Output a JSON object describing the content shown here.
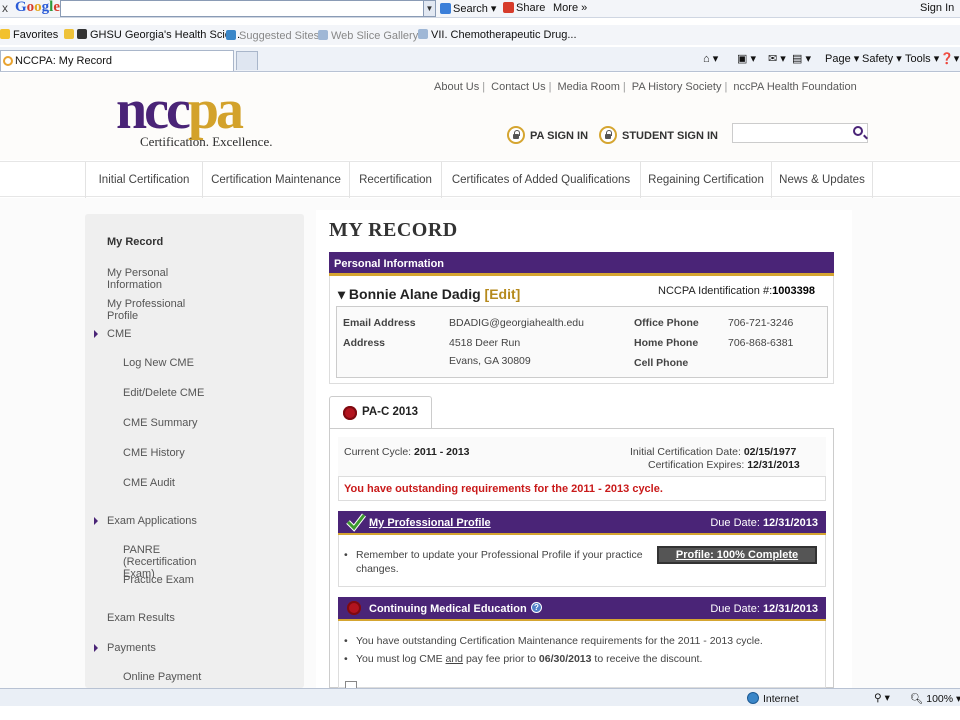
{
  "browser": {
    "close_glyph": "x",
    "google_label": "Google",
    "toolbar": {
      "search": "Search",
      "share": "Share",
      "more": "More »",
      "signin": "Sign In"
    },
    "favorites_label": "Favorites",
    "favorites": [
      "GHSU Georgia's Health Scie...",
      "Suggested Sites ▾",
      "Web Slice Gallery ▾",
      "VII. Chemotherapeutic Drug..."
    ],
    "tab_title": "NCCPA: My Record",
    "commands": {
      "page": "Page ▾",
      "safety": "Safety ▾",
      "tools": "Tools ▾"
    },
    "status": {
      "zone": "Internet",
      "zoom": "100%"
    }
  },
  "site": {
    "logo": {
      "text_left": "ncc",
      "text_right": "pa",
      "tagline": "Certification. Excellence."
    },
    "top_links": [
      "About Us",
      "Contact Us",
      "Media Room",
      "PA History Society",
      "nccPA Health Foundation"
    ],
    "pa_signin": "PA SIGN IN",
    "student_signin": "STUDENT SIGN IN",
    "search_placeholder": "",
    "nav": [
      "Initial Certification",
      "Certification Maintenance",
      "Recertification",
      "Certificates of Added Qualifications",
      "Regaining Certification",
      "News & Updates"
    ]
  },
  "sidebar": {
    "items": [
      "My Record",
      "My Personal Information",
      "My Professional Profile",
      "CME",
      "Log New CME",
      "Edit/Delete CME",
      "CME Summary",
      "CME History",
      "CME Audit",
      "Exam Applications",
      "PANRE (Recertification Exam)",
      "Practice Exam",
      "Exam Results",
      "Payments",
      "Online Payment"
    ]
  },
  "record": {
    "title": "MY RECORD",
    "personal_header": "Personal Information",
    "name": "Bonnie Alane Dadig",
    "edit": "[Edit]",
    "id_label": "NCCPA Identification #:",
    "id_value": "1003398",
    "email_label": "Email Address",
    "email": "BDADIG@georgiahealth.edu",
    "address_label": "Address",
    "address_line1": "4518 Deer Run",
    "address_line2": "Evans, GA 30809",
    "office_label": "Office Phone",
    "office": "706-721-3246",
    "home_label": "Home Phone",
    "home": "706-868-6381",
    "cell_label": "Cell Phone",
    "cell": ""
  },
  "cycle": {
    "tab": "PA-C 2013",
    "current_label": "Current Cycle:",
    "current_value": "2011 - 2013",
    "initial_label": "Initial Certification Date:",
    "initial_value": "02/15/1977",
    "expires_label": "Certification Expires:",
    "expires_value": "12/31/2013",
    "warning": "You have outstanding requirements for the 2011 - 2013 cycle."
  },
  "profile_section": {
    "title": "My Professional Profile",
    "due_label": "Due Date:",
    "due_value": "12/31/2013",
    "note": "Remember to update your Professional Profile if your practice changes.",
    "button": "Profile: 100% Complete"
  },
  "cme_section": {
    "title": "Continuing Medical Education",
    "due_label": "Due Date:",
    "due_value": "12/31/2013",
    "note1": "You have outstanding Certification Maintenance requirements for the 2011 - 2013 cycle.",
    "note2_a": "You must log CME",
    "note2_and": "and",
    "note2_b": "pay fee prior to",
    "note2_date": "06/30/2013",
    "note2_c": "to receive the discount."
  },
  "colors": {
    "purple": "#4a2477",
    "gold": "#d5a530",
    "warning_red": "#c91a1a"
  }
}
